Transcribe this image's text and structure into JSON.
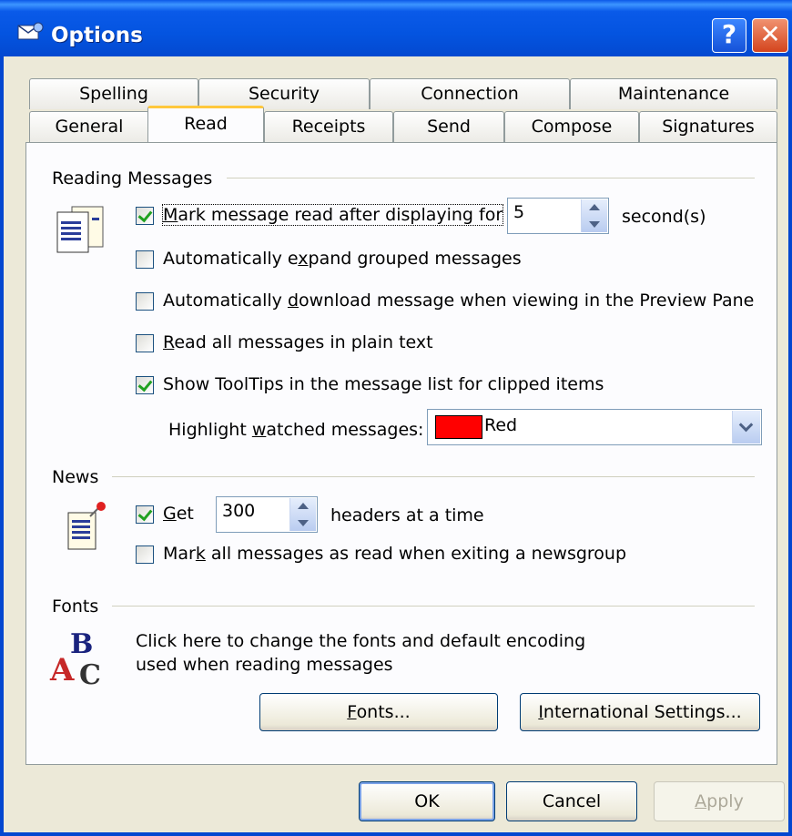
{
  "window": {
    "title": "Options",
    "help_label": "?",
    "close_label": "✕",
    "app_icon": "options-app-icon"
  },
  "tabs_row1": [
    {
      "label": "Spelling"
    },
    {
      "label": "Security"
    },
    {
      "label": "Connection"
    },
    {
      "label": "Maintenance"
    }
  ],
  "tabs_row2": [
    {
      "label": "General"
    },
    {
      "label": "Read",
      "active": true
    },
    {
      "label": "Receipts"
    },
    {
      "label": "Send"
    },
    {
      "label": "Compose"
    },
    {
      "label": "Signatures"
    }
  ],
  "reading": {
    "group_label": "Reading Messages",
    "mark_read_after": {
      "before": "",
      "hot": "M",
      "after": "ark message read after displaying for",
      "checked": true
    },
    "mark_read_seconds": "5",
    "seconds_label": "second(s)",
    "expand_grouped": {
      "before": "Automatically e",
      "hot": "x",
      "after": "pand grouped messages",
      "checked": false
    },
    "download_preview": {
      "before": "Automatically ",
      "hot": "d",
      "after": "ownload message when viewing in the Preview Pane",
      "checked": false
    },
    "plain_text": {
      "before": "",
      "hot": "R",
      "after": "ead all messages in plain text",
      "checked": false
    },
    "tooltips": {
      "before": "Show ToolTips in the message list for clipped items",
      "hot": "",
      "after": "",
      "checked": true
    },
    "highlight_label_before": "Highlight ",
    "highlight_label_hot": "w",
    "highlight_label_after": "atched messages:",
    "highlight_value": "Red",
    "highlight_color": "#ff0000"
  },
  "news": {
    "group_label": "News",
    "get": {
      "before": "",
      "hot": "G",
      "after": "et",
      "checked": true
    },
    "headers_count": "300",
    "headers_label": "headers at a time",
    "mark_all": {
      "before": "Mar",
      "hot": "k",
      "after": " all messages as read when exiting a newsgroup",
      "checked": false
    }
  },
  "fonts": {
    "group_label": "Fonts",
    "description_line1": "Click here to change the fonts and default encoding",
    "description_line2": "used when reading messages",
    "fonts_button_hot": "F",
    "fonts_button_rest": "onts...",
    "intl_button_hot": "I",
    "intl_button_rest": "nternational Settings..."
  },
  "footer": {
    "ok_label": "OK",
    "cancel_label": "Cancel",
    "apply_hot": "A",
    "apply_rest": "pply"
  }
}
